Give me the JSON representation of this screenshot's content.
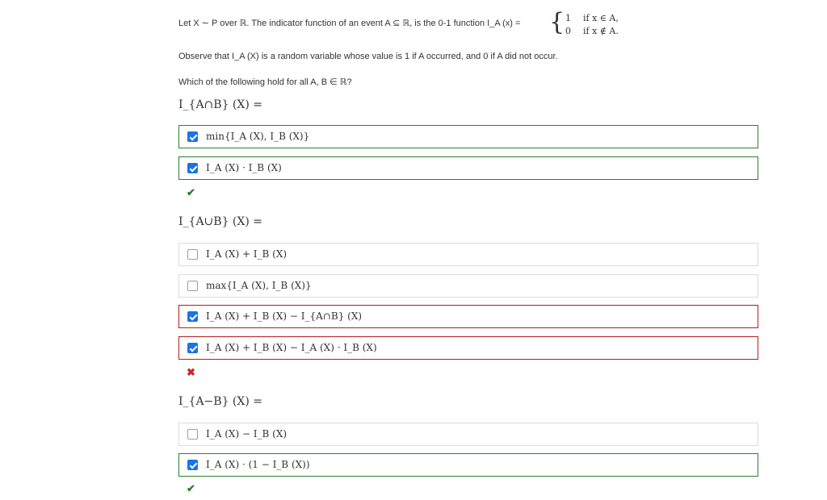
{
  "question": {
    "intro": "Let X ∼ P over ℝ. The indicator function of an event A ⊆ ℝ, is the 0-1 function I_A (x) =",
    "piecewise": {
      "case1_value": "1",
      "case1_cond": "if x ∈ A,",
      "case2_value": "0",
      "case2_cond": "if x ∉ A."
    },
    "observe": "Observe that I_A (X) is a random variable whose value is 1 if A occurred, and 0 if A did not occur.",
    "which": "Which of the following hold for all A, B ∈ ℝ?"
  },
  "parts": [
    {
      "heading": "I_{A∩B} (X) =",
      "options": [
        {
          "label": "min{I_A (X), I_B (X)}",
          "checked": true,
          "status": "correct"
        },
        {
          "label": "I_A (X) · I_B (X)",
          "checked": true,
          "status": "correct"
        }
      ],
      "result": "✔"
    },
    {
      "heading": "I_{A∪B} (X) =",
      "options": [
        {
          "label": "I_A (X) + I_B (X)",
          "checked": false,
          "status": "none"
        },
        {
          "label": "max{I_A (X), I_B (X)}",
          "checked": false,
          "status": "none"
        },
        {
          "label": "I_A (X) + I_B (X) − I_{A∩B} (X)",
          "checked": true,
          "status": "wrong"
        },
        {
          "label": "I_A (X) + I_B (X) − I_A (X) · I_B (X)",
          "checked": true,
          "status": "wrong"
        }
      ],
      "result": "✖"
    },
    {
      "heading": "I_{A−B} (X) =",
      "options": [
        {
          "label": "I_A (X) − I_B (X)",
          "checked": false,
          "status": "none"
        },
        {
          "label": "I_A (X) · (1 − I_B (X))",
          "checked": true,
          "status": "correct"
        }
      ],
      "result": "✔"
    }
  ],
  "colors": {
    "correct_border": "#2e7d32",
    "wrong_border": "#b71c1c",
    "checkbox_checked": "#1a73e8",
    "correct_mark": "#2e7d32",
    "wrong_mark": "#c62828"
  }
}
